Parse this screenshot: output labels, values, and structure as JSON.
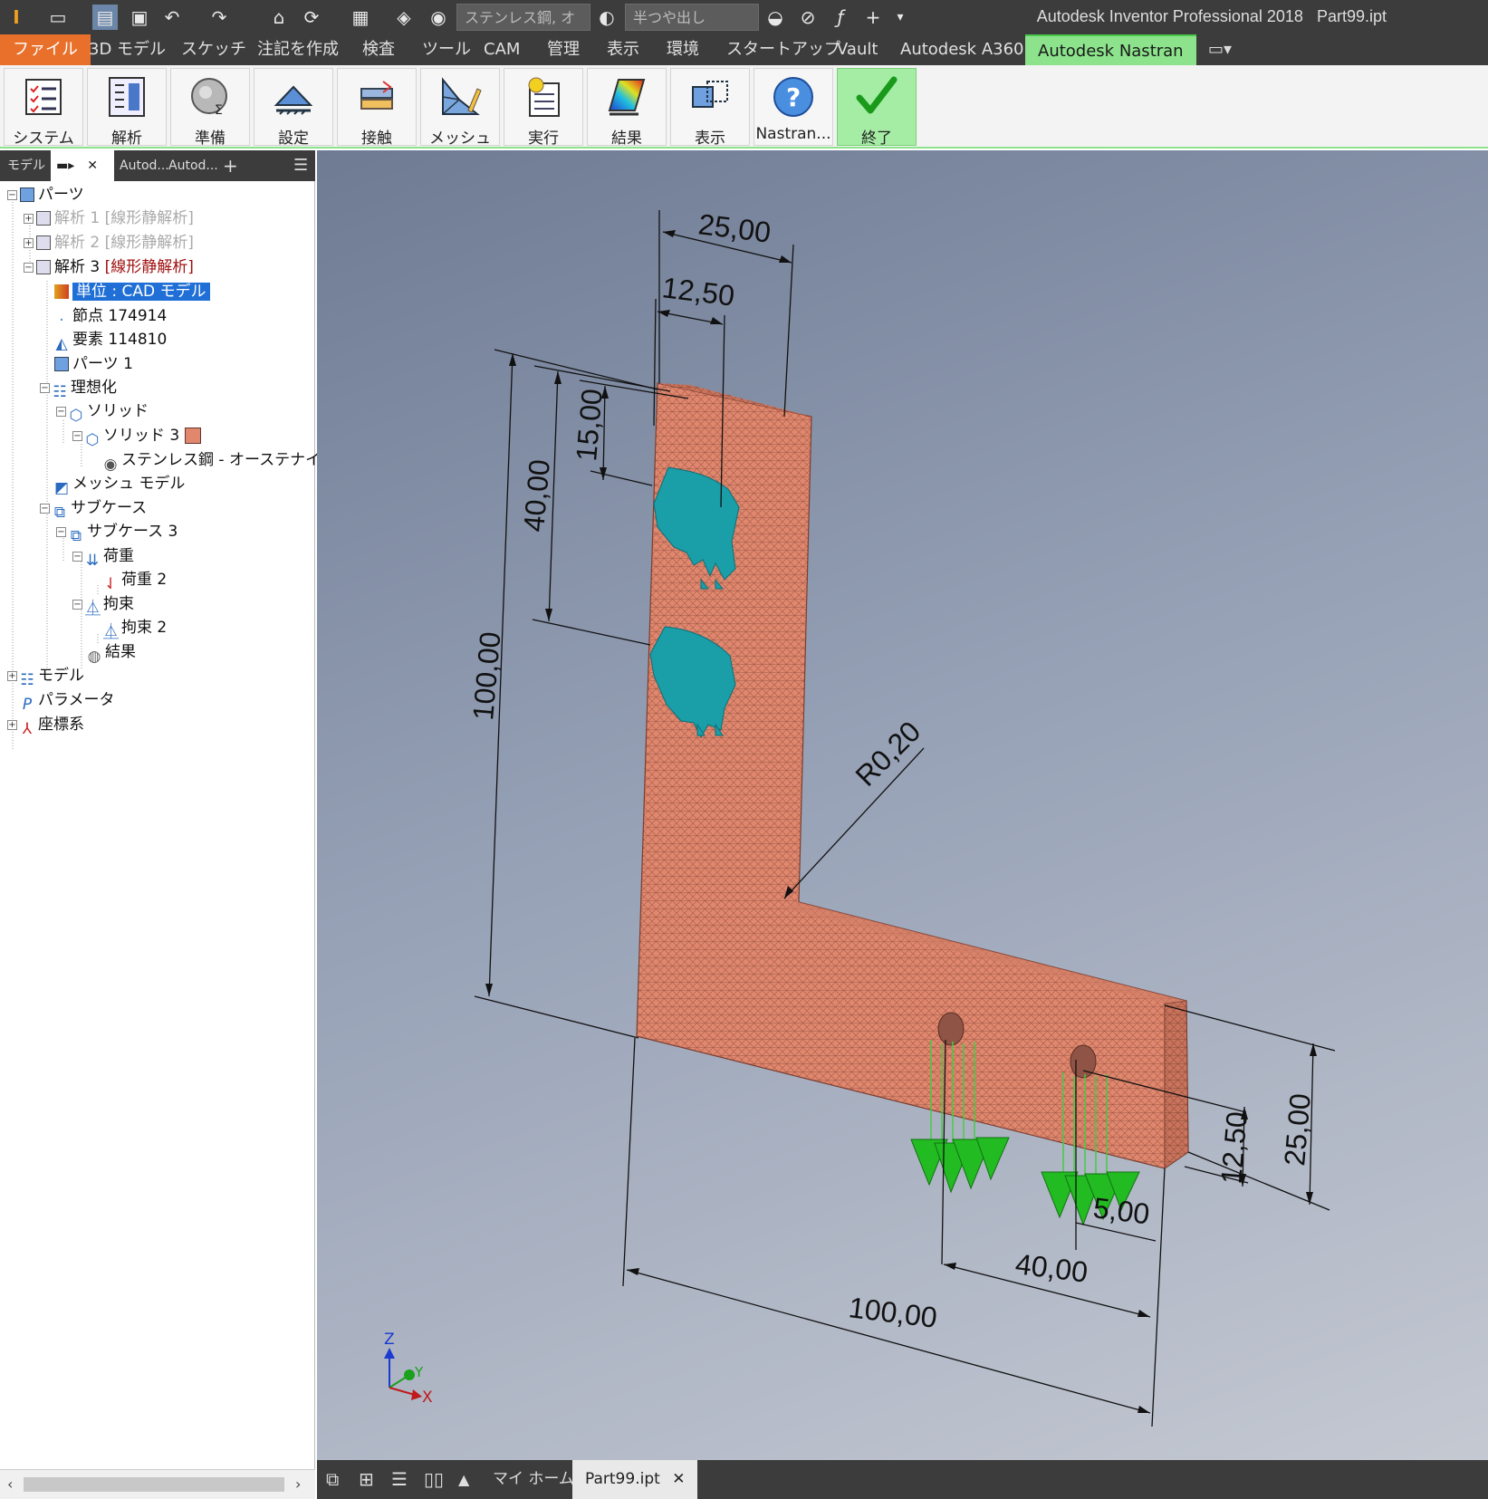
{
  "app": {
    "title": "Autodesk Inventor Professional 2018",
    "document": "Part99.ipt"
  },
  "quick_access": {
    "material_value": "ステンレス鋼, オ",
    "appearance_value": "半つや出し"
  },
  "menu": {
    "items": [
      "ファイル",
      "3D モデル",
      "スケッチ",
      "注記を作成",
      "検査",
      "ツール",
      "CAM",
      "管理",
      "表示",
      "環境",
      "スタートアップ",
      "Vault",
      "Autodesk A360",
      "Autodesk Nastran"
    ]
  },
  "ribbon": {
    "buttons": [
      "システム",
      "解析",
      "準備",
      "設定",
      "接触",
      "メッシュ",
      "実行",
      "結果",
      "表示",
      "Nastran...",
      "終了"
    ]
  },
  "browser": {
    "tab_model": "モデル",
    "tab_a": "Autod...",
    "tab_b": "Autod...",
    "tree": [
      "パーツ",
      "解析 1",
      "[線形静解析]",
      "解析 2",
      "[線形静解析]",
      "解析 3",
      "[線形静解析]",
      "単位 : CAD モデル",
      "節点 174914",
      "要素 114810",
      "パーツ 1",
      "理想化",
      "ソリッド",
      "ソリッド 3",
      "ステンレス鋼 - オーステナイト系",
      "メッシュ モデル",
      "サブケース",
      "サブケース 3",
      "荷重",
      "荷重 2",
      "拘束",
      "拘束 2",
      "結果",
      "モデル",
      "パラメータ",
      "座標系"
    ]
  },
  "viewport": {
    "dimensions": {
      "top_width": "25,00",
      "top_half": "12,50",
      "hole1_offset": "15,00",
      "hole_spacing_v": "40,00",
      "height": "100,00",
      "radius": "R0,20",
      "right_half": "12,50",
      "right_width": "25,00",
      "hole_edge": "5,00",
      "hole_spacing_h": "40,00",
      "length": "100,00"
    },
    "axis": {
      "z": "Z",
      "y": "Y",
      "x": "X"
    }
  },
  "status": {
    "home_tab": "マイ ホーム",
    "doc_tab": "Part99.ipt"
  },
  "colors": {
    "accent": "#8ce38c",
    "file_menu": "#e8702b",
    "mesh": "#e0876e",
    "constraint": "#1a9ea8",
    "load": "#22bb22"
  }
}
